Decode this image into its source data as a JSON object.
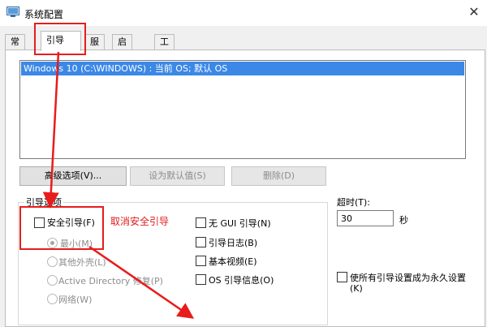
{
  "window": {
    "title": "系统配置"
  },
  "tabs": [
    "常规",
    "引导",
    "服务",
    "启动",
    "工具"
  ],
  "os_list": {
    "selected_entry": "Windows 10 (C:\\WINDOWS) : 当前 OS; 默认 OS"
  },
  "buttons": {
    "advanced": "高级选项(V)...",
    "set_default": "设为默认值(S)",
    "delete": "删除(D)"
  },
  "boot_options": {
    "group_label": "引导选项",
    "safe_boot": "安全引导(F)",
    "minimal": "最小(M)",
    "alternate_shell": "其他外壳(L)",
    "active_directory": "Active Directory 修复(P)",
    "network": "网络(W)",
    "no_gui": "无 GUI 引导(N)",
    "boot_log": "引导日志(B)",
    "base_video": "基本视频(E)",
    "os_boot_info": "OS 引导信息(O)"
  },
  "timeout": {
    "label": "超时(T):",
    "value": "30",
    "unit": "秒"
  },
  "permanent": {
    "label_line1": "使所有引导设置成为永久设置",
    "label_line2": "(K)"
  },
  "annotation": {
    "text": "取消安全引导",
    "color": "#e81c1c"
  }
}
